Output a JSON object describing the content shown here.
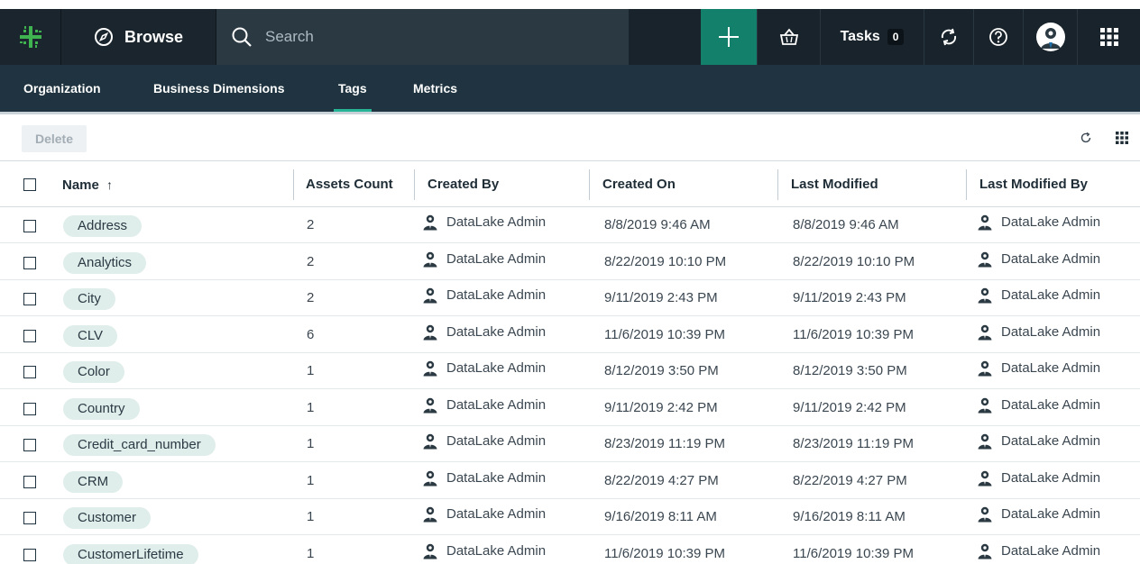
{
  "topbar": {
    "browse_label": "Browse",
    "search_placeholder": "Search",
    "tasks_label": "Tasks",
    "tasks_count": "0"
  },
  "subnav": {
    "tabs": [
      {
        "label": "Organization",
        "active": false
      },
      {
        "label": "Business Dimensions",
        "active": false
      },
      {
        "label": "Tags",
        "active": true
      },
      {
        "label": "Metrics",
        "active": false
      }
    ]
  },
  "toolbar": {
    "delete_label": "Delete"
  },
  "table": {
    "columns": {
      "name": "Name",
      "sort_indicator": "↑",
      "assets_count": "Assets Count",
      "created_by": "Created By",
      "created_on": "Created On",
      "last_modified": "Last Modified",
      "last_modified_by": "Last Modified By"
    },
    "rows": [
      {
        "name": "Address",
        "assets_count": "2",
        "created_by": "DataLake Admin",
        "created_on": "8/8/2019 9:46 AM",
        "last_modified": "8/8/2019 9:46 AM",
        "last_modified_by": "DataLake Admin"
      },
      {
        "name": "Analytics",
        "assets_count": "2",
        "created_by": "DataLake Admin",
        "created_on": "8/22/2019 10:10 PM",
        "last_modified": "8/22/2019 10:10 PM",
        "last_modified_by": "DataLake Admin"
      },
      {
        "name": "City",
        "assets_count": "2",
        "created_by": "DataLake Admin",
        "created_on": "9/11/2019 2:43 PM",
        "last_modified": "9/11/2019 2:43 PM",
        "last_modified_by": "DataLake Admin"
      },
      {
        "name": "CLV",
        "assets_count": "6",
        "created_by": "DataLake Admin",
        "created_on": "11/6/2019 10:39 PM",
        "last_modified": "11/6/2019 10:39 PM",
        "last_modified_by": "DataLake Admin"
      },
      {
        "name": "Color",
        "assets_count": "1",
        "created_by": "DataLake Admin",
        "created_on": "8/12/2019 3:50 PM",
        "last_modified": "8/12/2019 3:50 PM",
        "last_modified_by": "DataLake Admin"
      },
      {
        "name": "Country",
        "assets_count": "1",
        "created_by": "DataLake Admin",
        "created_on": "9/11/2019 2:42 PM",
        "last_modified": "9/11/2019 2:42 PM",
        "last_modified_by": "DataLake Admin"
      },
      {
        "name": "Credit_card_number",
        "assets_count": "1",
        "created_by": "DataLake Admin",
        "created_on": "8/23/2019 11:19 PM",
        "last_modified": "8/23/2019 11:19 PM",
        "last_modified_by": "DataLake Admin"
      },
      {
        "name": "CRM",
        "assets_count": "1",
        "created_by": "DataLake Admin",
        "created_on": "8/22/2019 4:27 PM",
        "last_modified": "8/22/2019 4:27 PM",
        "last_modified_by": "DataLake Admin"
      },
      {
        "name": "Customer",
        "assets_count": "1",
        "created_by": "DataLake Admin",
        "created_on": "9/16/2019 8:11 AM",
        "last_modified": "9/16/2019 8:11 AM",
        "last_modified_by": "DataLake Admin"
      },
      {
        "name": "CustomerLifetime",
        "assets_count": "1",
        "created_by": "DataLake Admin",
        "created_on": "11/6/2019 10:39 PM",
        "last_modified": "11/6/2019 10:39 PM",
        "last_modified_by": "DataLake Admin"
      }
    ]
  },
  "colors": {
    "topbar_bg": "#18232b",
    "subnav_bg": "#1f3440",
    "accent_green": "#12806a",
    "tab_underline": "#27b396",
    "tag_pill_bg": "#dfeeea"
  },
  "icons": [
    "app-logo-icon",
    "compass-icon",
    "search-icon",
    "plus-icon",
    "basket-icon",
    "sync-icon",
    "help-icon",
    "user-avatar-icon",
    "app-grid-icon",
    "refresh-icon",
    "columns-grid-icon",
    "user-icon",
    "checkbox-icon"
  ]
}
